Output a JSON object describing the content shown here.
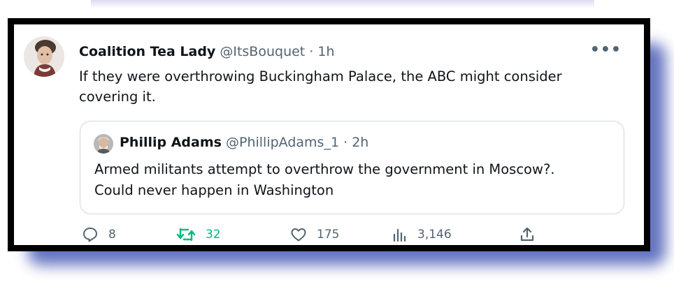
{
  "tweet": {
    "author_name": "Coalition Tea Lady",
    "handle": "@ItsBouquet",
    "separator": "·",
    "time": "1h",
    "text": "If they were overthrowing Buckingham Palace,  the ABC might consider covering  it."
  },
  "quoted": {
    "author_name": "Phillip Adams",
    "handle": "@PhillipAdams_1",
    "separator": "·",
    "time": "2h",
    "text_line1": "Armed militants attempt to overthrow the government in Moscow?.",
    "text_line2": "Could never happen in Washington"
  },
  "actions": {
    "replies": "8",
    "retweets": "32",
    "likes": "175",
    "views": "3,146"
  },
  "colors": {
    "retweet_active": "#00ba7c",
    "muted": "#536471",
    "shadow": "#4a5bb5",
    "frame": "#000000"
  },
  "icons": {
    "more": "more-icon",
    "reply": "reply-icon",
    "retweet": "retweet-icon",
    "like": "heart-icon",
    "views": "views-icon",
    "share": "share-icon"
  }
}
